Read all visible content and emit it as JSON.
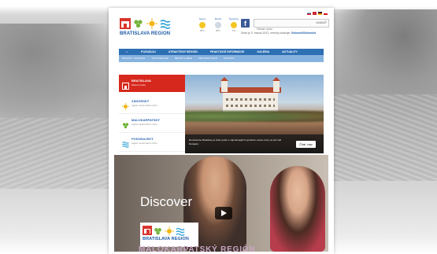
{
  "header": {
    "logo_text": "BRATISLAVA REGION",
    "weather": [
      {
        "name": "Senec",
        "temp": "8°C",
        "icon": "sun-icon"
      },
      {
        "name": "Modra",
        "temp": "8°C",
        "icon": "cloud-icon"
      },
      {
        "name": "Šenkvice",
        "temp": "7°C",
        "icon": "sun-icon"
      }
    ],
    "search_placeholder": "Hľadať výraz",
    "search_button": "HĽADAŤ",
    "date_prefix": "Dnes je 3. marca 2021, meniny oslavuje:",
    "date_name": "Bohumil/Bohumila"
  },
  "nav": {
    "items": [
      "POZNÁVAJ",
      "ATRAKTÍVNY REGIÓN",
      "PRAKTICKÉ INFORMÁCIE",
      "GALÉRIA",
      "AKTUALITY"
    ],
    "sub_items": [
      "REGIÓN V SKRATKE",
      "TOP ATRAKCIE",
      "MESTÁ A OBCE",
      "MESTSKÉ ČASTI",
      "KONTAKT"
    ]
  },
  "sidebar": {
    "items": [
      {
        "title": "BRATISLAVA",
        "sub": "hlavné mesto",
        "icon": "castle-icon",
        "active": true
      },
      {
        "title": "ZÁHORSKÝ",
        "sub": "región cestovného ruchu",
        "icon": "sun-icon",
        "active": false
      },
      {
        "title": "MALOKARPATSKÝ",
        "sub": "región cestovného ruchu",
        "icon": "grape-icon",
        "active": false
      },
      {
        "title": "PODUNAJSKÝ",
        "sub": "región cestovného ruchu",
        "icon": "wave-icon",
        "active": false
      }
    ]
  },
  "hero": {
    "caption": "Dominantou Bratislavy je hrad, jeden z najznámejších symbolov mesta, ktorý sa týči nad Dunajom.",
    "button": "Čítať viac"
  },
  "video": {
    "title": "Discover",
    "logo_text": "BRATISLAVA REGION"
  },
  "footer": {
    "title": "MALOKARPATSKÝ REGIÓN"
  },
  "colors": {
    "brand_blue": "#2d6fb3",
    "brand_red": "#d7281e",
    "light_blue": "#86b2df",
    "accent_pink": "#c9a6c3"
  }
}
